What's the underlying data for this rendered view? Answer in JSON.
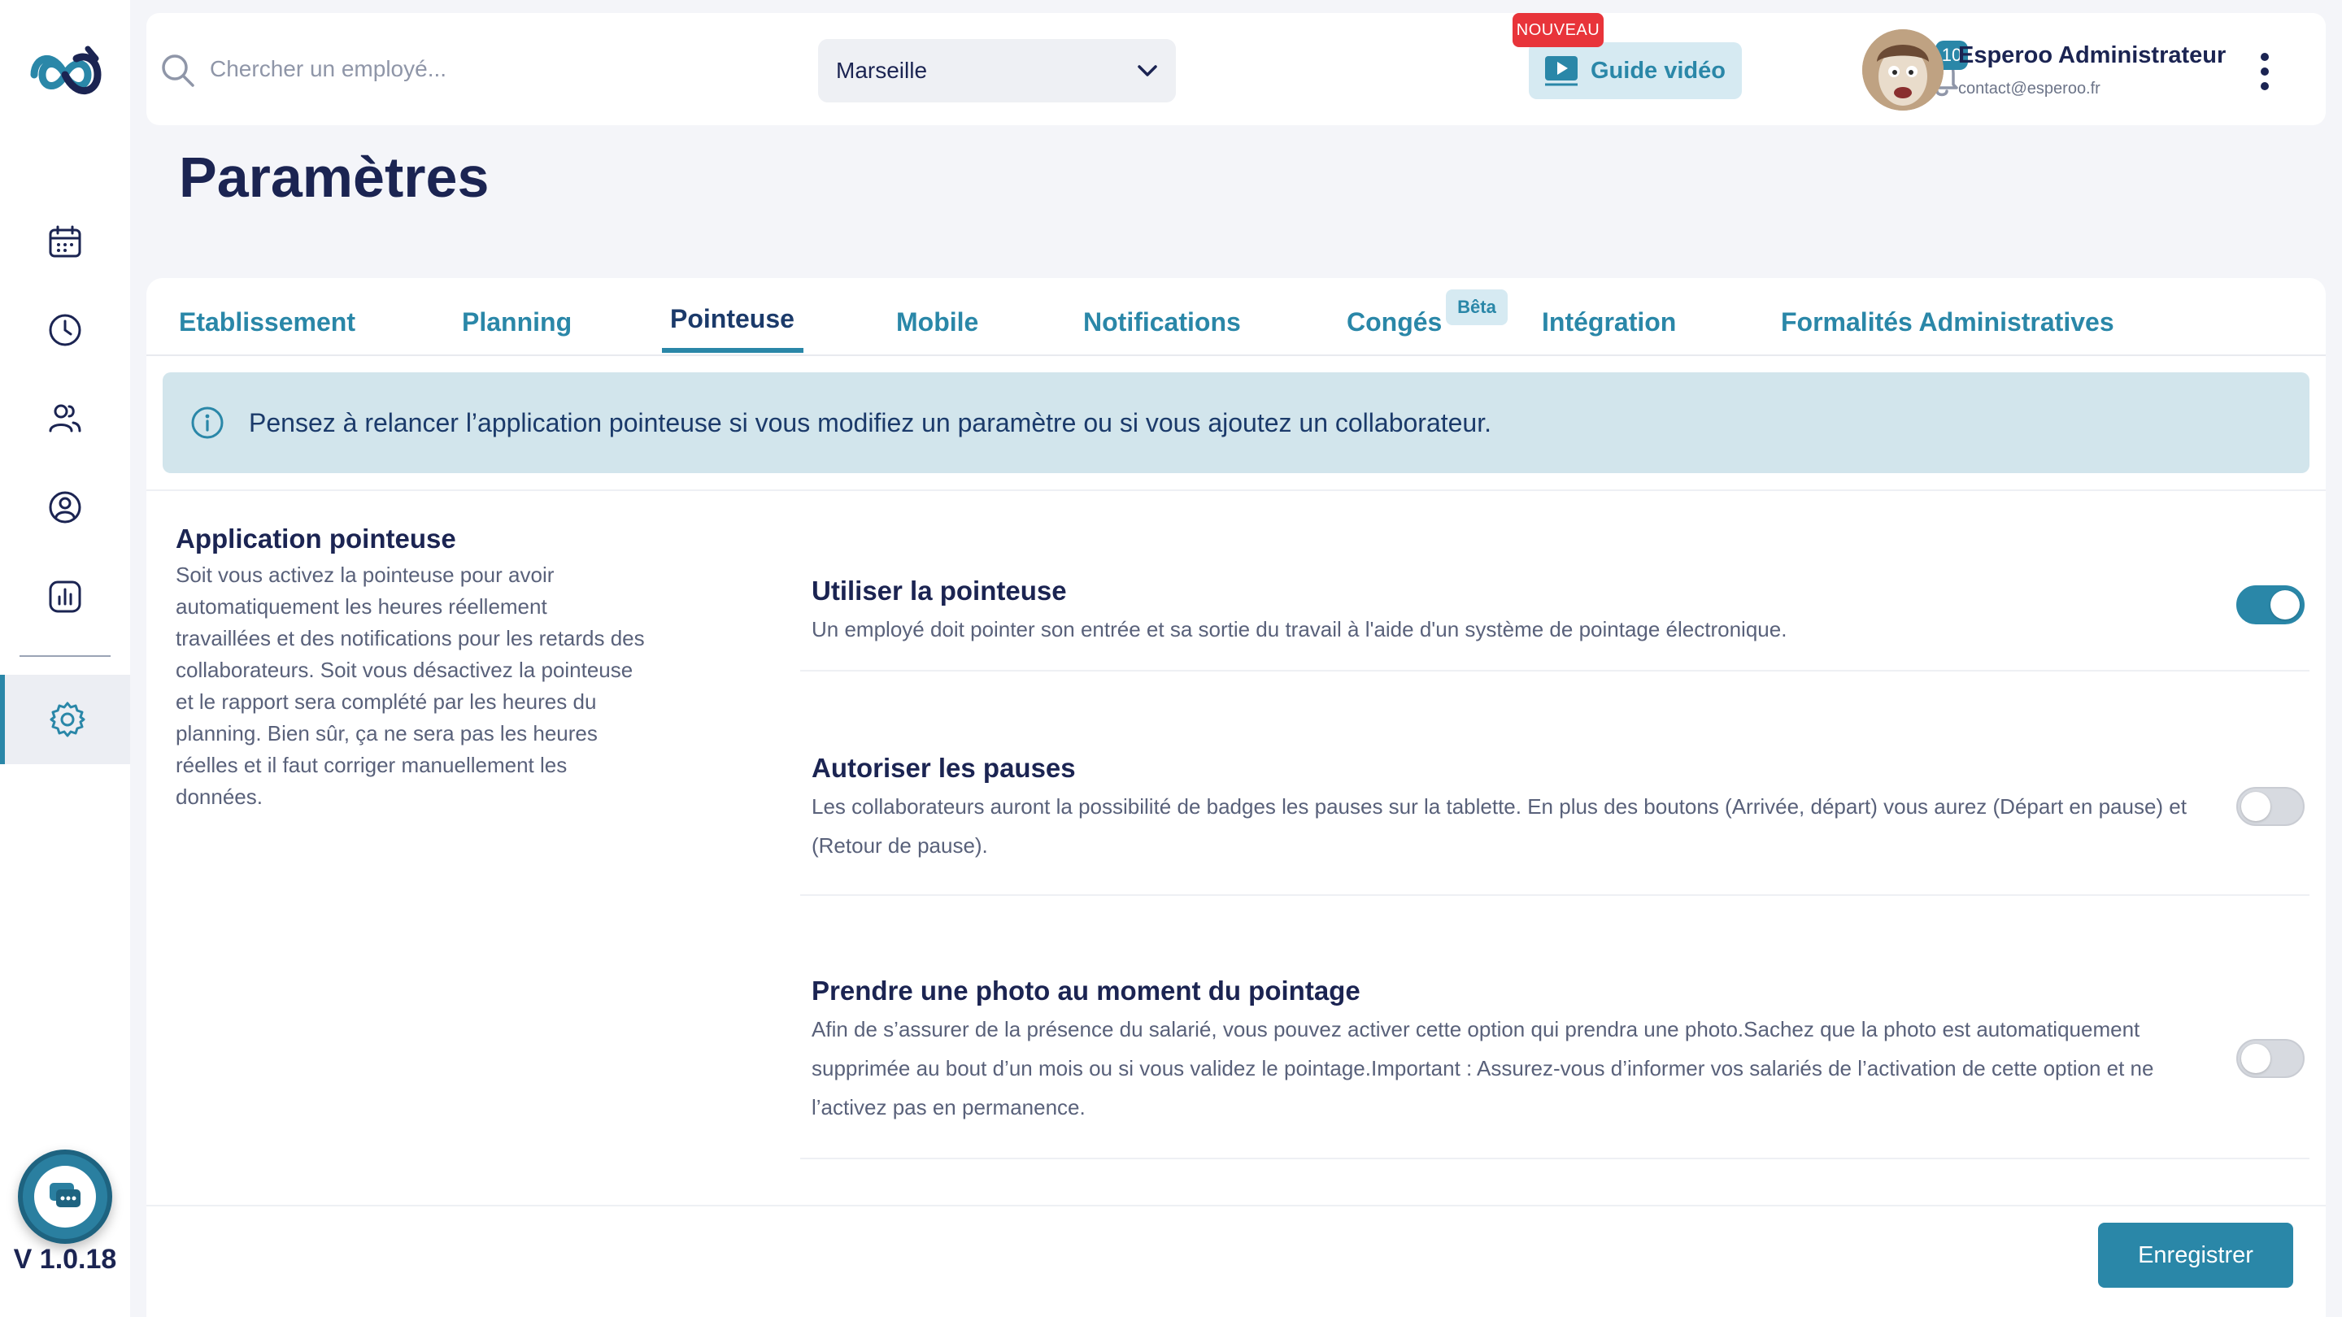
{
  "sidebar": {
    "logo_icon": "esperoo-infinity-logo",
    "items": [
      {
        "icon": "calendar-icon"
      },
      {
        "icon": "clock-icon"
      },
      {
        "icon": "users-icon"
      },
      {
        "icon": "user-circle-icon"
      },
      {
        "icon": "chart-icon"
      },
      {
        "icon": "gear-icon",
        "active": true
      }
    ],
    "chat_icon": "chat-icon",
    "version": "V 1.0.18"
  },
  "header": {
    "search_placeholder": "Chercher un employé...",
    "location": "Marseille",
    "guide_label": "Guide vidéo",
    "nouveau_label": "NOUVEAU",
    "notifications_count": "10",
    "user_name": "Esperoo Administrateur",
    "user_email": "contact@esperoo.fr"
  },
  "page": {
    "title": "Paramètres"
  },
  "tabs": [
    {
      "label": "Etablissement"
    },
    {
      "label": "Planning"
    },
    {
      "label": "Pointeuse",
      "active": true
    },
    {
      "label": "Mobile"
    },
    {
      "label": "Notifications"
    },
    {
      "label": "Congés"
    },
    {
      "label": "Intégration"
    },
    {
      "label": "Formalités Administratives"
    }
  ],
  "beta_label": "Bêta",
  "info_banner": "Pensez à relancer l’application pointeuse si vous modifiez un paramètre ou si vous ajoutez un collaborateur.",
  "section": {
    "title": "Application pointeuse",
    "description": "Soit vous activez la pointeuse pour avoir automatiquement les heures réellement travaillées et des notifications pour les retards des collaborateurs. Soit vous désactivez la pointeuse et le rapport sera complété par les heures du planning. Bien sûr, ça ne sera pas les heures réelles et il faut corriger manuellement les données."
  },
  "settings": [
    {
      "title": "Utiliser la pointeuse",
      "description": "Un employé doit pointer son entrée et sa sortie du travail à l'aide d'un système de pointage électronique.",
      "enabled": true
    },
    {
      "title": "Autoriser les pauses",
      "description": "Les collaborateurs auront la possibilité de badges les pauses sur la tablette. En plus des boutons (Arrivée, départ) vous aurez (Départ en pause) et (Retour de pause).",
      "enabled": false
    },
    {
      "title": "Prendre une photo au moment du pointage",
      "description": "Afin de s’assurer de la présence du salarié, vous pouvez activer cette option qui prendra une photo.Sachez que la photo est automatiquement supprimée au bout d’un mois ou si vous validez le pointage.Important : Assurez-vous d’informer vos salariés de l’activation de cette option et ne l’activez pas en permanence.",
      "enabled": false
    }
  ],
  "footer": {
    "save_label": "Enregistrer"
  },
  "colors": {
    "accent": "#2a87a8",
    "navy": "#1b2452",
    "banner": "#d2e5ec",
    "badge_red": "#e8343a"
  }
}
